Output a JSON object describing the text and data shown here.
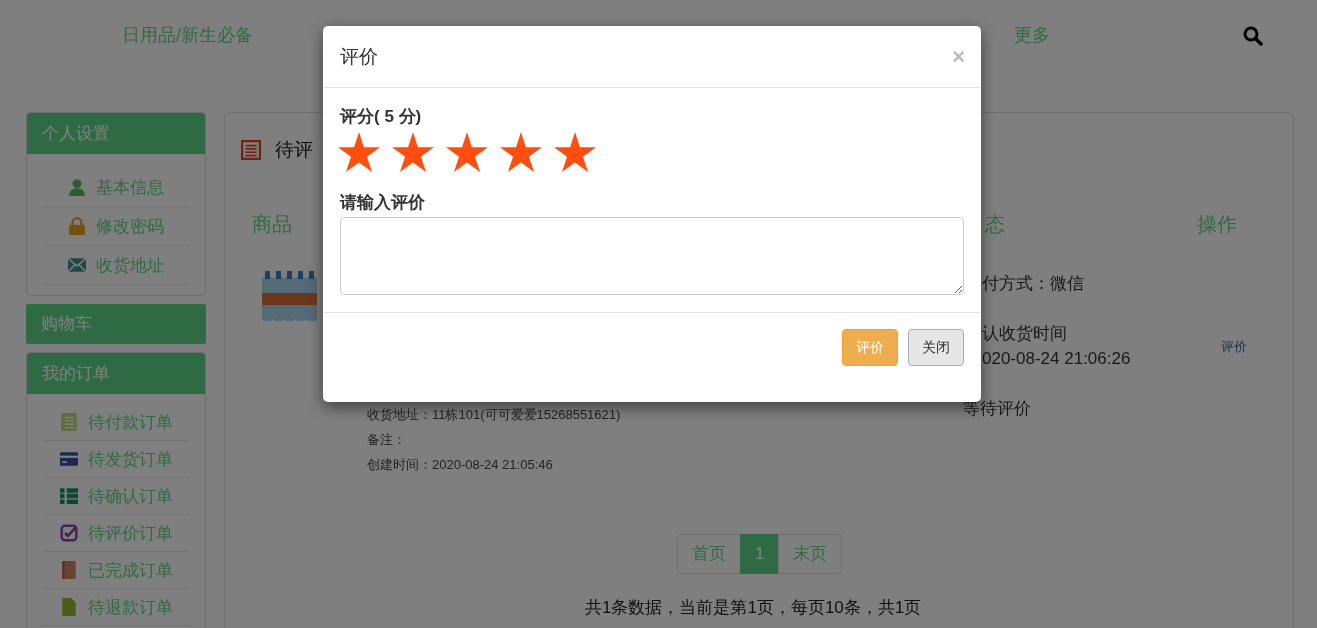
{
  "nav": {
    "items": [
      "日用品/新生必备",
      "更多"
    ]
  },
  "sidebar": {
    "panels": [
      {
        "title": "个人设置",
        "items": [
          "基本信息",
          "修改密码",
          "收货地址"
        ]
      },
      {
        "title": "购物车"
      },
      {
        "title": "我的订单",
        "items": [
          "待付款订单",
          "待发货订单",
          "待确认订单",
          "待评价订单",
          "已完成订单",
          "待退款订单"
        ]
      }
    ]
  },
  "main": {
    "title": "待评",
    "columns": [
      "商品",
      "态",
      "操作"
    ],
    "order": {
      "details": [
        "收货地址：11栋101(可可爱爱15268551621)",
        "备注：",
        "创建时间：2020-08-24 21:05:46"
      ],
      "status_lines": [
        "付方式：微信",
        "认收货时间",
        "020-08-24 21:06:26"
      ],
      "status": "等待评价",
      "action": "评价"
    }
  },
  "pagination": {
    "pages": [
      {
        "label": "首页",
        "selected": false
      },
      {
        "label": "1",
        "selected": true
      },
      {
        "label": "末页",
        "selected": false
      }
    ],
    "summary": "共1条数据，当前是第1页，每页10条，共1页"
  },
  "modal": {
    "title": "评价",
    "close": "×",
    "rating_label": "评分( 5 分)",
    "rating": {
      "stars": 5
    },
    "comment_label": "请输入评价",
    "buttons": [
      {
        "label": "评价",
        "kind": "primary"
      },
      {
        "label": "关闭",
        "kind": "default"
      }
    ]
  }
}
